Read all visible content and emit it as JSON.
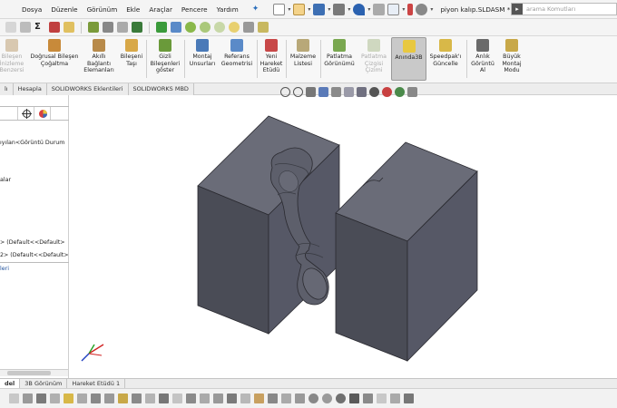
{
  "menu": {
    "items": [
      "Dosya",
      "Düzenle",
      "Görünüm",
      "Ekle",
      "Araçlar",
      "Pencere",
      "Yardım"
    ],
    "filename": "piyon kalıp.SLDASM *",
    "search_placeholder": "arama Komutları"
  },
  "command_manager": {
    "items": [
      {
        "label": "Bileşen\nİnizleme\nBenzersi",
        "icon": "insert-component-icon",
        "disabled": true
      },
      {
        "label": "Doğrusal Bileşen\nÇoğaltma",
        "icon": "linear-pattern-icon",
        "disabled": false
      },
      {
        "label": "Akıllı\nBağlantı\nElemanları",
        "icon": "smart-fasteners-icon",
        "disabled": false
      },
      {
        "label": "Bileşeni\nTaşı",
        "icon": "move-component-icon",
        "disabled": false
      },
      {
        "label": "Gizli\nBileşenleri\ngöster",
        "icon": "show-hidden-icon",
        "disabled": false
      },
      {
        "label": "Montaj\nUnsurları",
        "icon": "assembly-features-icon",
        "disabled": false
      },
      {
        "label": "Referans\nGeometrisi",
        "icon": "reference-geometry-icon",
        "disabled": false
      },
      {
        "label": "Yeni\nHareket\nEtüdü",
        "icon": "motion-study-icon",
        "disabled": false
      },
      {
        "label": "Malzeme\nListesi",
        "icon": "bom-icon",
        "disabled": false
      },
      {
        "label": "Patlatma\nGörünümü",
        "icon": "exploded-view-icon",
        "disabled": false
      },
      {
        "label": "Patlatma\nÇizgisi\nÇizimi",
        "icon": "explode-line-icon",
        "disabled": true
      },
      {
        "label": "Anında3B",
        "icon": "instant3d-icon",
        "disabled": false,
        "active": true
      },
      {
        "label": "Speedpak'ı\nGüncelle",
        "icon": "speedpak-icon",
        "disabled": false
      },
      {
        "label": "Anlık\nGörüntü\nAl",
        "icon": "snapshot-icon",
        "disabled": false
      },
      {
        "label": "Büyük\nMontaj\nModu",
        "icon": "large-assembly-icon",
        "disabled": false
      }
    ]
  },
  "tabs": [
    "lı",
    "Hesapla",
    "SOLIDWORKS Eklentileri",
    "SOLIDWORKS MBD"
  ],
  "left_panel": {
    "lines": [
      {
        "text": "ıyılan<Görüntü Durum",
        "selected": false
      },
      {
        "text": "alar",
        "selected": false
      },
      {
        "text": "> (Default<<Default>",
        "selected": false
      },
      {
        "text": "2> (Default<<Default>",
        "selected": false
      },
      {
        "text": "leri",
        "selected": true
      }
    ]
  },
  "bottom_tabs": [
    {
      "label": "del",
      "active": true
    },
    {
      "label": "3B Görünüm",
      "active": false
    },
    {
      "label": "Hareket Etüdü 1",
      "active": false
    }
  ],
  "colors": {
    "mold_top": "#6a6c78",
    "mold_side": "#4a4c56",
    "mold_front": "#565866",
    "accent_blue": "#2a6ebb"
  }
}
